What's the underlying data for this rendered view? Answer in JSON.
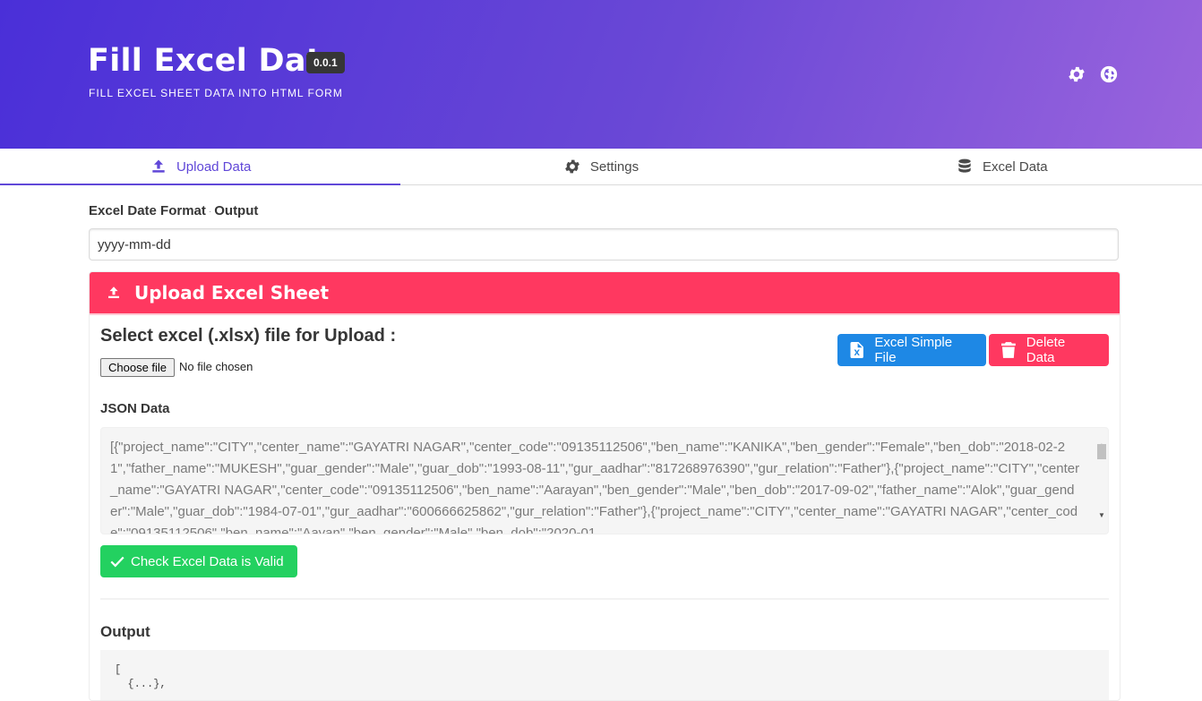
{
  "header": {
    "title": "Fill Excel Data",
    "version": "0.0.1",
    "subtitle": "FILL EXCEL SHEET DATA INTO HTML FORM"
  },
  "tabs": [
    {
      "label": "Upload Data",
      "icon": "upload-icon",
      "active": true
    },
    {
      "label": "Settings",
      "icon": "gear-icon",
      "active": false
    },
    {
      "label": "Excel Data",
      "icon": "database-icon",
      "active": false
    }
  ],
  "form": {
    "label_main": "Excel Date Format",
    "label_sep": "·",
    "label_sub": "Output",
    "date_format_value": "yyyy-mm-dd"
  },
  "upload_panel": {
    "heading": "Upload Excel Sheet",
    "select_title": "Select excel (.xlsx) file for Upload :",
    "file_button": "Choose file",
    "file_status": "No file chosen",
    "simple_file_button": "Excel Simple File",
    "delete_button": "Delete Data",
    "json_label": "JSON Data",
    "json_text": "[{\"project_name\":\"CITY\",\"center_name\":\"GAYATRI NAGAR\",\"center_code\":\"09135112506\",\"ben_name\":\"KANIKA\",\"ben_gender\":\"Female\",\"ben_dob\":\"2018-02-21\",\"father_name\":\"MUKESH\",\"guar_gender\":\"Male\",\"guar_dob\":\"1993-08-11\",\"gur_aadhar\":\"817268976390\",\"gur_relation\":\"Father\"},{\"project_name\":\"CITY\",\"center_name\":\"GAYATRI NAGAR\",\"center_code\":\"09135112506\",\"ben_name\":\"Aarayan\",\"ben_gender\":\"Male\",\"ben_dob\":\"2017-09-02\",\"father_name\":\"Alok\",\"guar_gender\":\"Male\",\"guar_dob\":\"1984-07-01\",\"gur_aadhar\":\"600666625862\",\"gur_relation\":\"Father\"},{\"project_name\":\"CITY\",\"center_name\":\"GAYATRI NAGAR\",\"center_code\":\"09135112506\",\"ben_name\":\"Aayan\",\"ben_gender\":\"Male\",\"ben_dob\":\"2020-01",
    "check_button": "Check Excel Data is Valid",
    "output_label": "Output",
    "output_text": "[\n  {...},"
  },
  "colors": {
    "hero_start": "#4a2fd8",
    "hero_end": "#9a64dd",
    "accent": "#6047d8",
    "danger": "#ff3860",
    "info": "#1e88e5",
    "success": "#23d160"
  }
}
